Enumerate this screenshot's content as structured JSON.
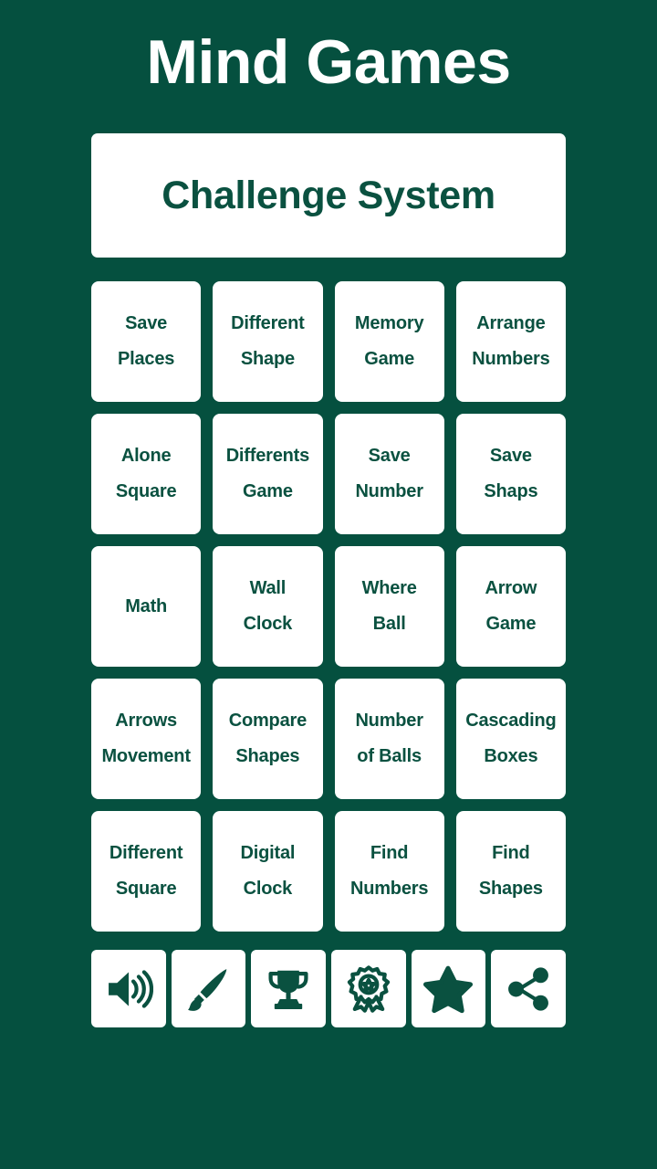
{
  "app": {
    "title": "Mind Games",
    "background_color": "#05503F",
    "tile_color": "#FFFFFF",
    "text_color": "#0A5140"
  },
  "banner": {
    "label": "Challenge System"
  },
  "games": [
    {
      "line1": "Save",
      "line2": "Places",
      "label": "Save Places"
    },
    {
      "line1": "Different",
      "line2": "Shape",
      "label": "Different Shape"
    },
    {
      "line1": "Memory",
      "line2": "Game",
      "label": "Memory Game"
    },
    {
      "line1": "Arrange",
      "line2": "Numbers",
      "label": "Arrange Numbers"
    },
    {
      "line1": "Alone",
      "line2": "Square",
      "label": "Alone Square"
    },
    {
      "line1": "Differents",
      "line2": "Game",
      "label": "Differents Game"
    },
    {
      "line1": "Save",
      "line2": "Number",
      "label": "Save Number"
    },
    {
      "line1": "Save",
      "line2": "Shaps",
      "label": "Save Shaps"
    },
    {
      "line1": "Math",
      "line2": "",
      "label": "Math"
    },
    {
      "line1": "Wall",
      "line2": "Clock",
      "label": "Wall Clock"
    },
    {
      "line1": "Where",
      "line2": "Ball",
      "label": "Where Ball"
    },
    {
      "line1": "Arrow",
      "line2": "Game",
      "label": "Arrow Game"
    },
    {
      "line1": "Arrows",
      "line2": "Movement",
      "label": "Arrows Movement"
    },
    {
      "line1": "Compare",
      "line2": "Shapes",
      "label": "Compare Shapes"
    },
    {
      "line1": "Number",
      "line2": "of Balls",
      "label": "Number of Balls"
    },
    {
      "line1": "Cascading",
      "line2": "Boxes",
      "label": "Cascading Boxes"
    },
    {
      "line1": "Different",
      "line2": "Square",
      "label": "Different Square"
    },
    {
      "line1": "Digital",
      "line2": "Clock",
      "label": "Digital Clock"
    },
    {
      "line1": "Find",
      "line2": "Numbers",
      "label": "Find Numbers"
    },
    {
      "line1": "Find",
      "line2": "Shapes",
      "label": "Find Shapes"
    }
  ],
  "toolbar": [
    {
      "icon": "sound-icon"
    },
    {
      "icon": "paintbrush-icon"
    },
    {
      "icon": "trophy-icon"
    },
    {
      "icon": "medal-icon"
    },
    {
      "icon": "star-icon"
    },
    {
      "icon": "share-icon"
    }
  ]
}
